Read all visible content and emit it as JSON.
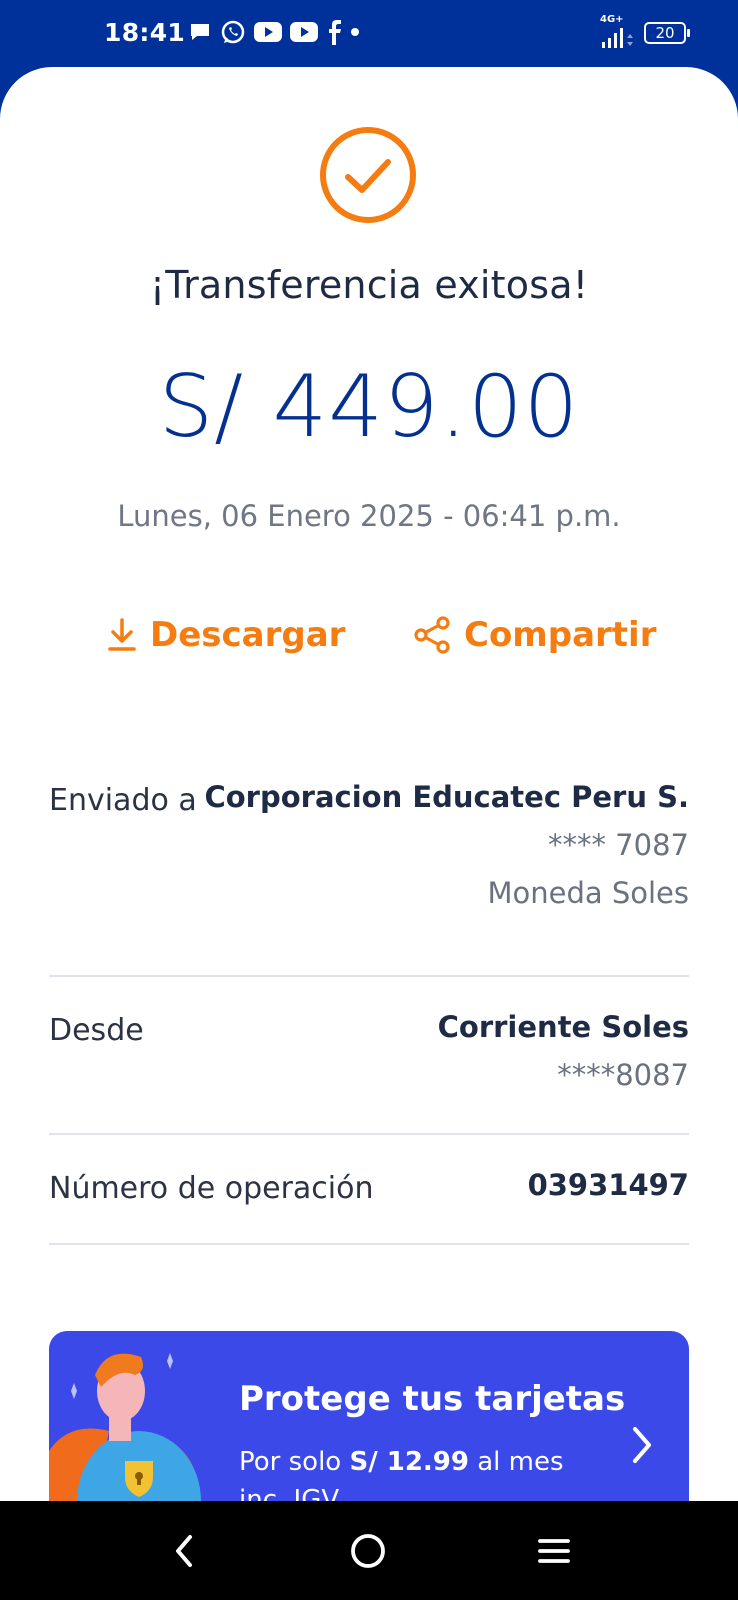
{
  "status_bar": {
    "time": "18:41",
    "network": "4G+",
    "battery": "20",
    "icons": [
      "chat-icon",
      "whatsapp-icon",
      "youtube-icon",
      "youtube-icon",
      "facebook-icon",
      "dot-icon"
    ]
  },
  "result": {
    "title": "¡Transferencia exitosa!",
    "amount": "S/ 449.00",
    "datetime": "Lunes, 06 Enero 2025 - 06:41 p.m."
  },
  "actions": {
    "download_label": "Descargar",
    "share_label": "Compartir"
  },
  "details": {
    "sent_to": {
      "label": "Enviado a",
      "name": "Corporacion Educatec Peru S.",
      "account": "**** 7087",
      "currency": "Moneda Soles"
    },
    "from": {
      "label": "Desde",
      "account_name": "Corriente Soles",
      "account_number": "****8087"
    },
    "operation": {
      "label": "Número de operación",
      "value": "03931497"
    }
  },
  "promo": {
    "title": "Protege tus tarjetas",
    "sub_prefix": "Por solo",
    "sub_price": "S/ 12.99",
    "sub_suffix": "al mes",
    "sub_line2": "inc. IGV"
  },
  "colors": {
    "brand_blue": "#00319b",
    "accent_orange": "#f57c10",
    "promo_blue": "#3b49e8"
  }
}
